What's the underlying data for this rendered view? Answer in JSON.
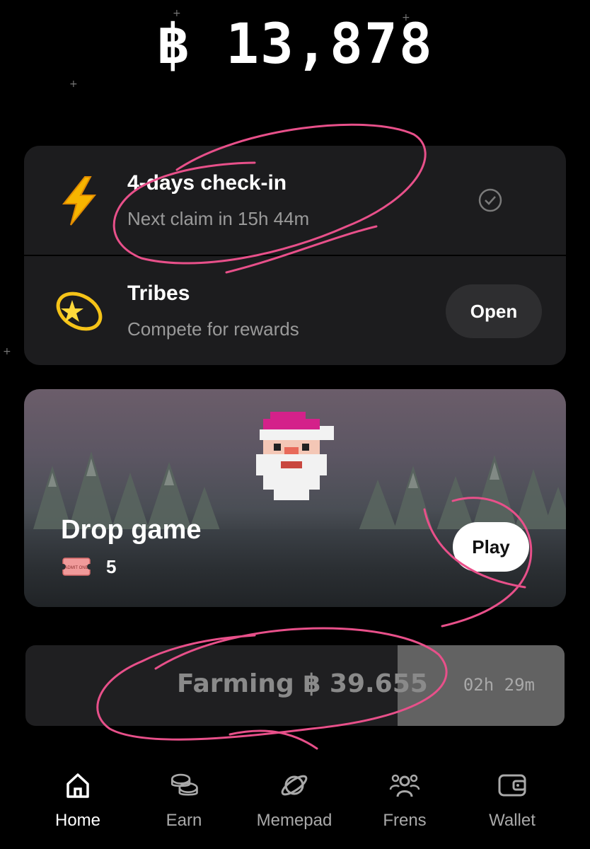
{
  "balance": "฿ 13,878",
  "tasks": [
    {
      "title": "4-days check-in",
      "subtitle": "Next claim in 15h 44m",
      "icon": "lightning-icon",
      "status_icon": "check-circle-icon"
    },
    {
      "title": "Tribes",
      "subtitle": "Compete for rewards",
      "icon": "shooting-star-icon",
      "button_label": "Open"
    }
  ],
  "drop_game": {
    "title": "Drop game",
    "tickets": "5",
    "ticket_icon_text": "ADMIT ONE",
    "play_label": "Play",
    "character_icon": "pixel-santa-icon"
  },
  "farming": {
    "label": "Farming ฿ 39.655",
    "time_left": "02h 29m",
    "progress": 0.69
  },
  "nav": [
    {
      "label": "Home",
      "icon": "home-icon",
      "active": true
    },
    {
      "label": "Earn",
      "icon": "coins-icon",
      "active": false
    },
    {
      "label": "Memepad",
      "icon": "planet-icon",
      "active": false
    },
    {
      "label": "Frens",
      "icon": "friends-icon",
      "active": false
    },
    {
      "label": "Wallet",
      "icon": "wallet-icon",
      "active": false
    }
  ],
  "colors": {
    "background": "#000000",
    "card": "#1c1c1e",
    "annotation": "#e8508a",
    "farming_fill": "#626262"
  }
}
